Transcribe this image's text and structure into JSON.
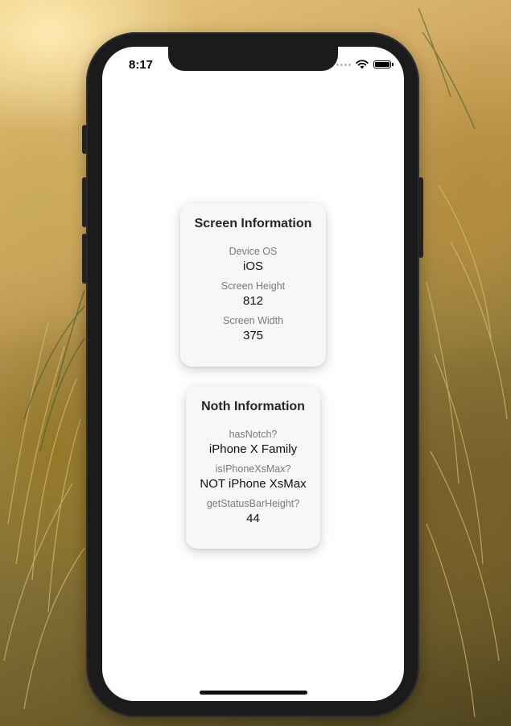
{
  "status_bar": {
    "time": "8:17"
  },
  "screen_card": {
    "title": "Screen Information",
    "fields": [
      {
        "label": "Device OS",
        "value": "iOS"
      },
      {
        "label": "Screen Height",
        "value": "812"
      },
      {
        "label": "Screen Width",
        "value": "375"
      }
    ]
  },
  "notch_card": {
    "title": "Noth Information",
    "fields": [
      {
        "label": "hasNotch?",
        "value": "iPhone X Family"
      },
      {
        "label": "isIPhoneXsMax?",
        "value": "NOT iPhone XsMax"
      },
      {
        "label": "getStatusBarHeight?",
        "value": "44"
      }
    ]
  },
  "icons": [
    "cellular-signal-icon",
    "wifi-icon",
    "battery-icon"
  ]
}
